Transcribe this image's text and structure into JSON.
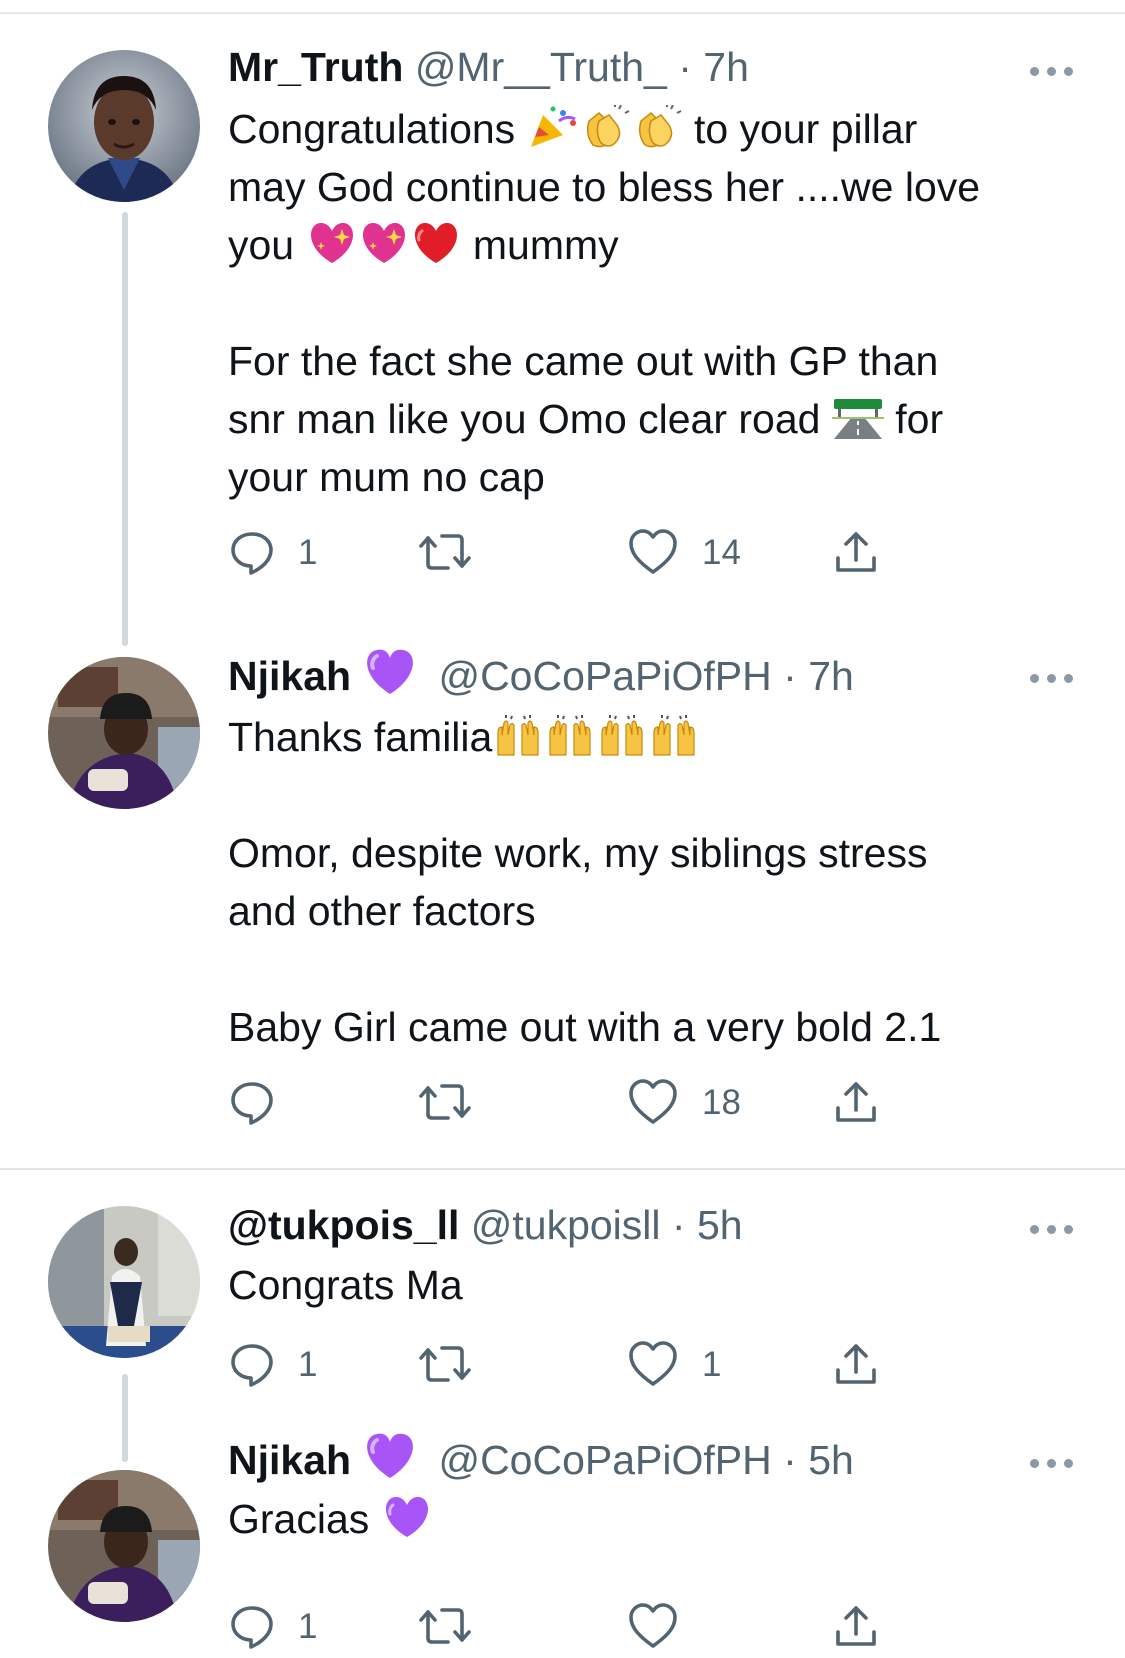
{
  "tweets": [
    {
      "name": "Mr_Truth",
      "handle": "@Mr__Truth_",
      "dot": "·",
      "time": "7h",
      "verified_badge": "",
      "lines": [
        [
          {
            "t": "Congratulations "
          },
          {
            "e": "party-popper"
          },
          {
            "e": "clapping-hands"
          },
          {
            "e": "clapping-hands"
          },
          {
            "t": " to your pillar"
          }
        ],
        [
          {
            "t": "may God continue to bless her ....we love"
          }
        ],
        [
          {
            "t": "you "
          },
          {
            "e": "sparkling-heart"
          },
          {
            "e": "sparkling-heart"
          },
          {
            "e": "red-heart"
          },
          {
            "t": " mummy"
          }
        ],
        [
          {
            "t": ""
          }
        ],
        [
          {
            "t": "For the fact she came out with GP than"
          }
        ],
        [
          {
            "t": "snr man like you Omo clear road "
          },
          {
            "e": "motorway"
          },
          {
            "t": " for"
          }
        ],
        [
          {
            "t": "your mum no cap"
          }
        ]
      ],
      "replies": "1",
      "retweets": "",
      "likes": "14"
    },
    {
      "name": "Njikah",
      "handle": "@CoCoPaPiOfPH",
      "dot": "·",
      "time": "7h",
      "verified_badge": "purple-heart",
      "lines": [
        [
          {
            "t": "Thanks familia"
          },
          {
            "e": "raising-hands"
          },
          {
            "e": "raising-hands"
          },
          {
            "e": "raising-hands"
          },
          {
            "e": "raising-hands"
          }
        ],
        [
          {
            "t": ""
          }
        ],
        [
          {
            "t": "Omor, despite work, my siblings stress"
          }
        ],
        [
          {
            "t": "and other factors"
          }
        ],
        [
          {
            "t": ""
          }
        ],
        [
          {
            "t": "Baby Girl came out with a very bold 2.1"
          }
        ]
      ],
      "replies": "",
      "retweets": "",
      "likes": "18"
    },
    {
      "name": "@tukpois_ll",
      "handle": "@tukpoisll",
      "dot": "·",
      "time": "5h",
      "verified_badge": "",
      "lines": [
        [
          {
            "t": "Congrats Ma"
          }
        ]
      ],
      "replies": "1",
      "retweets": "",
      "likes": "1"
    },
    {
      "name": "Njikah",
      "handle": "@CoCoPaPiOfPH",
      "dot": "·",
      "time": "5h",
      "verified_badge": "purple-heart",
      "lines": [
        [
          {
            "t": "Gracias "
          },
          {
            "e": "purple-heart"
          }
        ]
      ],
      "replies": "1",
      "retweets": "",
      "likes": ""
    }
  ],
  "icons": {
    "reply": "reply-icon",
    "retweet": "retweet-icon",
    "like": "heart-icon",
    "share": "share-icon",
    "more": "more-options-icon"
  },
  "colors": {
    "text": "#0f1419",
    "secondary": "#536471",
    "thread_line": "#cfd9de",
    "divider": "#e1e5e8",
    "badge_purple": "#a855f7"
  }
}
